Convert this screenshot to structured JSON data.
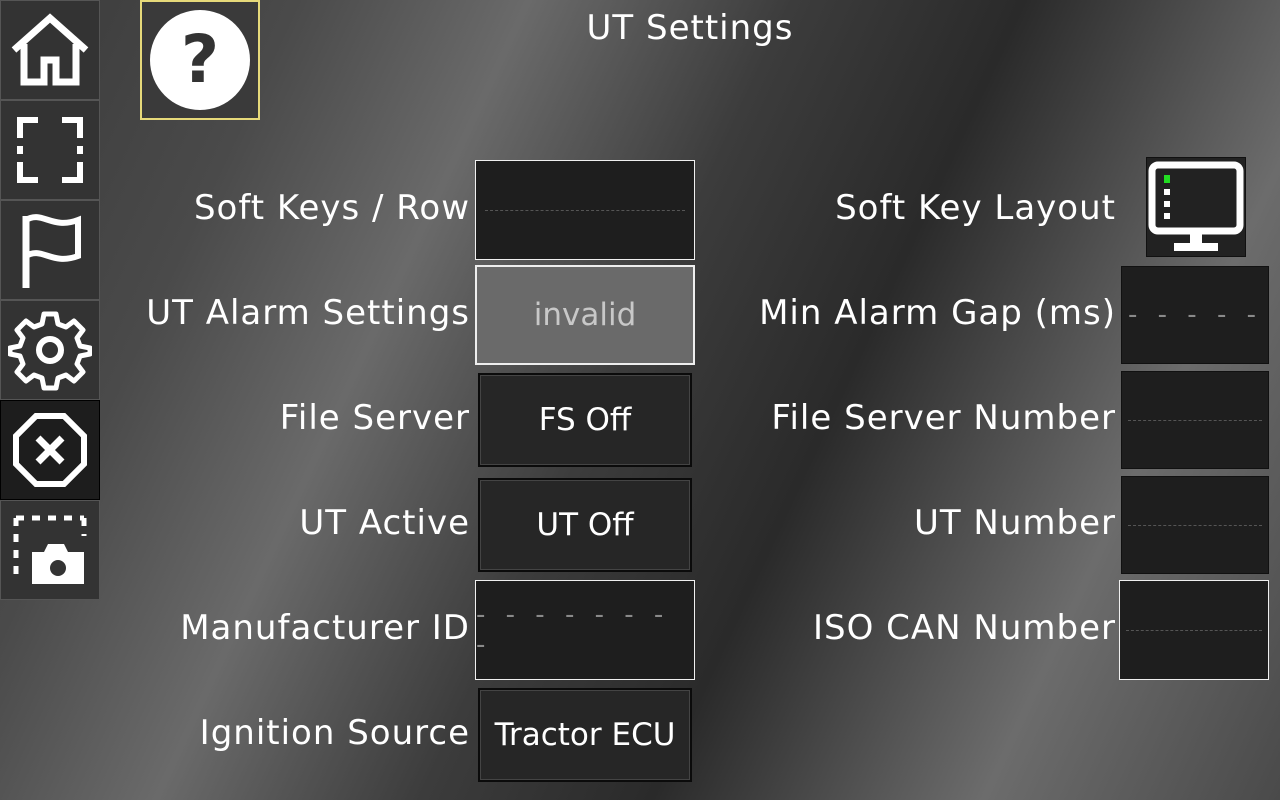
{
  "title": "UT Settings",
  "sidebar": {
    "items": [
      {
        "name": "home",
        "icon": "home-icon"
      },
      {
        "name": "fullscreen",
        "icon": "fullscreen-icon"
      },
      {
        "name": "flag",
        "icon": "flag-icon"
      },
      {
        "name": "settings",
        "icon": "gear-icon"
      },
      {
        "name": "close",
        "icon": "close-icon",
        "active": true
      },
      {
        "name": "screenshot",
        "icon": "camera-icon"
      }
    ]
  },
  "help": {
    "icon": "help-icon",
    "glyph": "?"
  },
  "settings": {
    "soft_keys_row": {
      "label": "Soft Keys / Row",
      "value": ""
    },
    "ut_alarm": {
      "label": "UT Alarm Settings",
      "value": "invalid"
    },
    "file_server": {
      "label": "File Server",
      "value": "FS Off"
    },
    "ut_active": {
      "label": "UT Active",
      "value": "UT Off"
    },
    "manufacturer_id": {
      "label": "Manufacturer ID",
      "value": "- - - - - - - -"
    },
    "ignition_source": {
      "label": "Ignition Source",
      "value": "Tractor ECU"
    },
    "soft_key_layout": {
      "label": "Soft Key Layout",
      "icon": "monitor-icon"
    },
    "min_alarm_gap": {
      "label": "Min Alarm Gap (ms)",
      "value": "- - - - -"
    },
    "file_server_number": {
      "label": "File Server Number",
      "value": ""
    },
    "ut_number": {
      "label": "UT Number",
      "value": ""
    },
    "iso_can_number": {
      "label": "ISO CAN Number",
      "value": ""
    }
  },
  "colors": {
    "help_border": "#e6d97a",
    "indicator": "#22dd22"
  }
}
